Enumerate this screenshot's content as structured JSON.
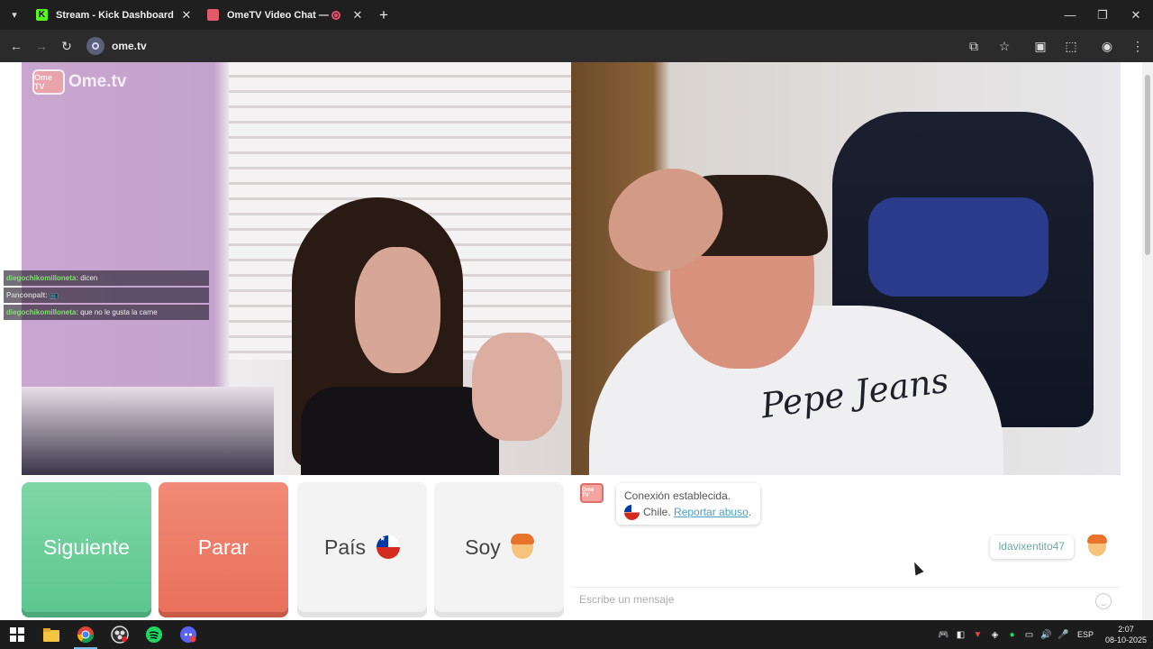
{
  "browser": {
    "tabs": [
      {
        "title": "Stream - Kick Dashboard",
        "favicon_color": "#53fc18",
        "favicon_letter": "K"
      },
      {
        "title": "OmeTV Video Chat — Ome",
        "favicon_color": "#e05a6a",
        "recording": true
      }
    ],
    "url": "ome.tv",
    "icons": {
      "tab_menu": "chevron-down-icon",
      "back": "back-arrow-icon",
      "forward": "forward-arrow-icon",
      "reload": "reload-icon",
      "cast": "cast-icon",
      "bookmark": "star-icon",
      "extensions": "puzzle-icon",
      "profile": "profile-icon",
      "menu": "kebab-menu-icon"
    }
  },
  "video": {
    "logo_text": "Ome.tv",
    "logo_badge": "Ome TV",
    "overlay_chat": [
      {
        "user": "diegochikomilloneta:",
        "message": "dicen",
        "user_color": "#7ee36e"
      },
      {
        "user": "Panconpalt:",
        "message": "📺",
        "user_color": "#cccccc"
      },
      {
        "user": "diegochikomilloneta:",
        "message": "que no le gusta la carne",
        "user_color": "#7ee36e"
      }
    ]
  },
  "controls": {
    "next_label": "Siguiente",
    "stop_label": "Parar",
    "country_label": "País",
    "gender_label": "Soy",
    "colors": {
      "next": "#6fcf99",
      "stop": "#ec7b66"
    }
  },
  "chat": {
    "system_badge": "Ome TV",
    "system_line1": "Conexión establecida.",
    "system_country": "Chile.",
    "report_link": "Reportar abuso",
    "report_suffix": ".",
    "user_message": "ldavixentito47",
    "input_placeholder": "Escribe un mensaje"
  },
  "taskbar": {
    "apps": [
      "windows-start-icon",
      "file-explorer-icon",
      "chrome-icon",
      "obs-icon",
      "spotify-icon",
      "discord-icon"
    ],
    "tray_language": "ESP",
    "time": "2:07",
    "date": "08-10-2025"
  }
}
